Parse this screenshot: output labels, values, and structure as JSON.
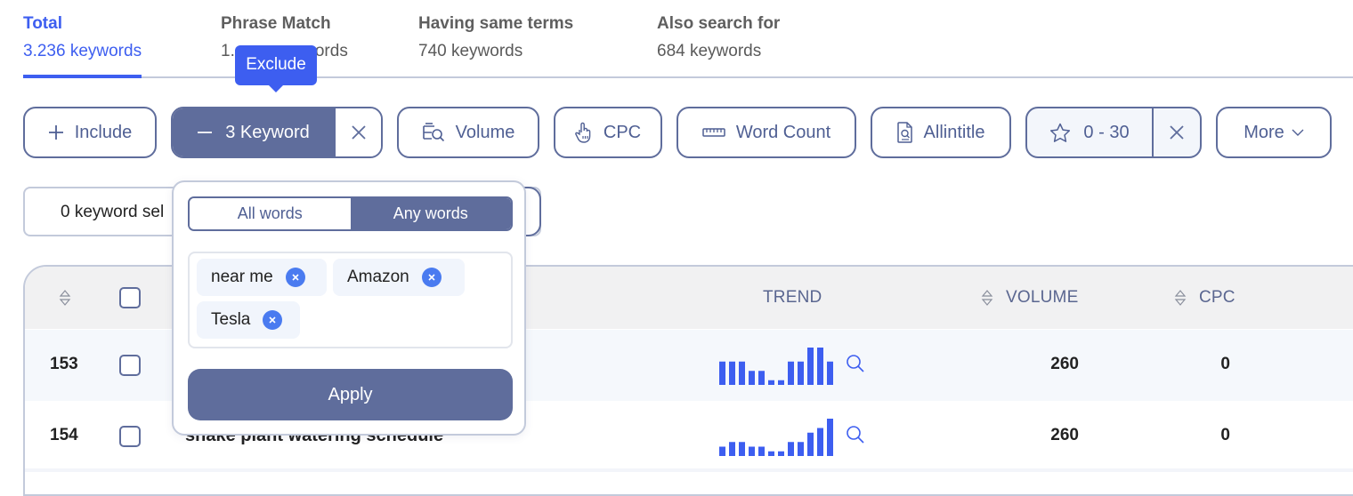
{
  "tabs": [
    {
      "title": "Total",
      "count": "3.236 keywords",
      "active": true
    },
    {
      "title": "Phrase Match",
      "count": "1.___ keywords",
      "active": false
    },
    {
      "title": "Having same terms",
      "count": "740 keywords",
      "active": false
    },
    {
      "title": "Also search for",
      "count": "684 keywords",
      "active": false
    }
  ],
  "phrase_match_visible_count_left": "1.",
  "phrase_match_visible_count_right": "ords",
  "tooltip": {
    "text": "Exclude"
  },
  "filters": {
    "include": {
      "label": "Include",
      "icon": "plus-icon"
    },
    "exclude": {
      "label": "3 Keyword",
      "icon": "minus-icon",
      "clear_icon": "close-icon"
    },
    "volume": {
      "label": "Volume",
      "icon": "volume-search-icon"
    },
    "cpc": {
      "label": "CPC",
      "icon": "hand-pointer-icon"
    },
    "word_count": {
      "label": "Word Count",
      "icon": "ruler-icon"
    },
    "allintitle": {
      "label": "Allintitle",
      "icon": "document-search-icon"
    },
    "rating": {
      "label": "0 - 30",
      "icon": "star-icon",
      "clear_icon": "close-icon"
    },
    "more": {
      "label": "More",
      "icon": "chevron-down-icon"
    }
  },
  "selection": {
    "text": "0 keyword sel"
  },
  "popover": {
    "modes": [
      {
        "label": "All words",
        "selected": false
      },
      {
        "label": "Any words",
        "selected": true
      }
    ],
    "chips": [
      "near me",
      "Amazon",
      "Tesla"
    ],
    "apply_label": "Apply"
  },
  "table": {
    "columns": {
      "trend": "TREND",
      "volume": "VOLUME",
      "cpc": "CPC"
    },
    "rows": [
      {
        "num": "153",
        "keyword": "",
        "trend": [
          5,
          5,
          5,
          3,
          3,
          1,
          1,
          5,
          5,
          8,
          8,
          5
        ],
        "volume": "260",
        "cpc": "0"
      },
      {
        "num": "154",
        "keyword": "snake plant watering schedule",
        "trend": [
          2,
          3,
          3,
          2,
          2,
          1,
          1,
          3,
          3,
          5,
          6,
          8
        ],
        "volume": "260",
        "cpc": "0"
      }
    ]
  },
  "colors": {
    "accent": "#3d5ef0",
    "filter": "#5f6d9c",
    "chip_remove": "#4a7bf0",
    "trend_bar": "#3d5ef0"
  }
}
